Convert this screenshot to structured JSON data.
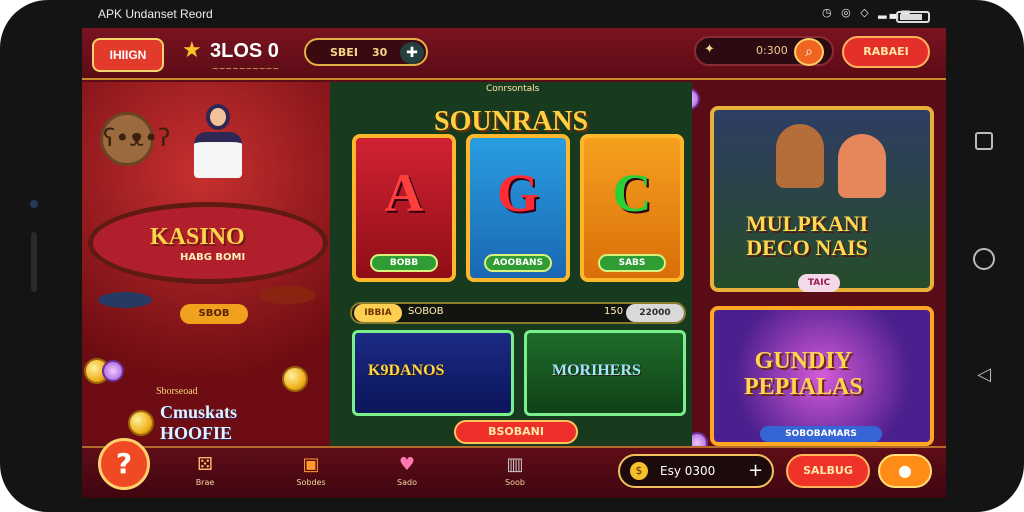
{
  "status_bar": {
    "title": "APK Undanset Reord",
    "icons": "◷ ◎ ◇ ▂▃▅"
  },
  "top_bar": {
    "logo_text": "IHIIGN",
    "coins": "3LOS 0",
    "bet_label": "SBEI",
    "bet_value": "30",
    "search_value": "0:300",
    "action_label": "RABAEI"
  },
  "left_panel": {
    "casino_title": "KASINO",
    "casino_subtitle": "HABG BOMI",
    "casino_button": "SBOB",
    "promo_subtitle": "Sborseoad",
    "promo_title_line1": "Cmuskats",
    "promo_title_line2": "HOOFIE"
  },
  "center_panel": {
    "subtitle": "Conrsontals",
    "title": "SOUNRANS",
    "reels": [
      {
        "symbol": "A",
        "chip": "BOBB"
      },
      {
        "symbol": "G",
        "chip": "AOOBANS"
      },
      {
        "symbol": "C",
        "chip": "SABS"
      }
    ],
    "bar": {
      "tag": "IBBIA",
      "left_value": "SOBOB",
      "right_value": "150",
      "right_tag": "22000"
    },
    "mini_cards": [
      "K9DANOS",
      "MORIHERS"
    ],
    "claim_button": "BSOBANI"
  },
  "right_top": {
    "title_line1": "MULPKANI",
    "title_line2": "DECO NAIS",
    "chip": "TAIC"
  },
  "right_bottom": {
    "title_line1": "GUNDIY",
    "title_line2": "PEPIALAS",
    "button": "SOBOBAMARS"
  },
  "bottom_nav": {
    "items": [
      {
        "label": "Brae",
        "icon": "dice-icon"
      },
      {
        "label": "Sobdes",
        "icon": "chest-icon"
      },
      {
        "label": "Sado",
        "icon": "heart-icon"
      },
      {
        "label": "Soob",
        "icon": "building-icon"
      }
    ],
    "balance": "Esy 0300",
    "action_label": "SALBUG"
  },
  "colors": {
    "brand_red": "#e52f2a",
    "gold": "#ffd141",
    "dark_bg": "#5a0d16"
  }
}
